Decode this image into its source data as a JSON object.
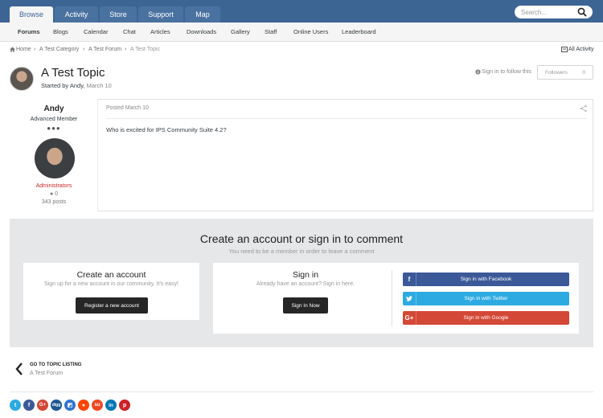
{
  "topnav": {
    "tabs": [
      {
        "label": "Browse",
        "active": true
      },
      {
        "label": "Activity"
      },
      {
        "label": "Store"
      },
      {
        "label": "Support"
      },
      {
        "label": "Map"
      }
    ],
    "search_placeholder": "Search..."
  },
  "subnav": {
    "items": [
      "Forums",
      "Blogs",
      "Calendar",
      "Chat",
      "Articles",
      "Downloads",
      "Gallery",
      "Staff",
      "Online Users",
      "Leaderboard"
    ]
  },
  "breadcrumb": {
    "items": [
      "Home",
      "A Test Category",
      "A Test Forum",
      "A Test Topic"
    ],
    "all_activity": "All Activity"
  },
  "topic": {
    "title": "A Test Topic",
    "started_by_prefix": "Started by",
    "author": "Andy,",
    "date": "March 10",
    "follow_text": "Sign in to follow this",
    "followers_label": "Followers",
    "followers_count": "0"
  },
  "post": {
    "author_name": "Andy",
    "rank": "Advanced Member",
    "rank_pips": "●●●",
    "group": "Administrators",
    "reputation": "0",
    "post_count": "343 posts",
    "posted": "Posted March 10",
    "body": "Who is excited for IPS Community Suite 4.2?"
  },
  "comment": {
    "title": "Create an account or sign in to comment",
    "subtitle": "You need to be a member in order to leave a comment",
    "create": {
      "title": "Create an account",
      "subtitle": "Sign up for a new account in our community. It's easy!",
      "button": "Register a new account"
    },
    "signin": {
      "title": "Sign in",
      "subtitle": "Already have an account? Sign in here.",
      "button": "Sign In Now"
    },
    "social": [
      {
        "label": "Sign in with Facebook",
        "color": "#3b5998",
        "icon": "f"
      },
      {
        "label": "Sign in with Twitter",
        "color": "#2daae1",
        "icon": "t"
      },
      {
        "label": "Sign in with Google",
        "color": "#d34836",
        "icon": "G+"
      }
    ]
  },
  "back": {
    "title": "GO TO TOPIC LISTING",
    "subtitle": "A Test Forum"
  },
  "share_icons": [
    {
      "name": "twitter",
      "color": "#2daae1"
    },
    {
      "name": "facebook",
      "color": "#3b5998"
    },
    {
      "name": "google-plus",
      "color": "#d34836"
    },
    {
      "name": "digg",
      "color": "#1b5791"
    },
    {
      "name": "delicious",
      "color": "#3274d1"
    },
    {
      "name": "reddit",
      "color": "#ff4500"
    },
    {
      "name": "stumbleupon",
      "color": "#eb4924"
    },
    {
      "name": "linkedin",
      "color": "#0077b5"
    },
    {
      "name": "pinterest",
      "color": "#cb2027"
    }
  ]
}
